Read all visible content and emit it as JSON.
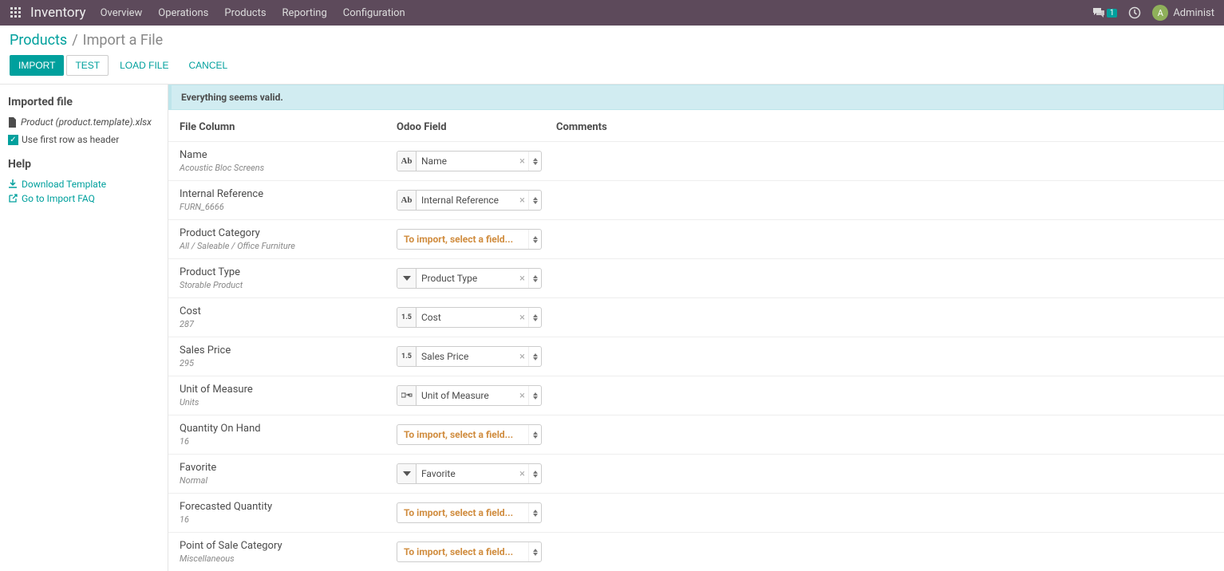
{
  "topbar": {
    "app_name": "Inventory",
    "nav": [
      "Overview",
      "Operations",
      "Products",
      "Reporting",
      "Configuration"
    ],
    "chat_badge": "1",
    "user_initial": "A",
    "user_name": "Administ"
  },
  "breadcrumb": {
    "parent": "Products",
    "current": "Import a File"
  },
  "actions": {
    "import": "IMPORT",
    "test": "TEST",
    "load": "LOAD FILE",
    "cancel": "CANCEL"
  },
  "sidebar": {
    "imported_title": "Imported file",
    "file_name": "Product (product.template).xlsx",
    "first_row_label": "Use first row as header",
    "help_title": "Help",
    "download_template": "Download Template",
    "import_faq": "Go to Import FAQ"
  },
  "alert": "Everything seems valid.",
  "headers": {
    "file_column": "File Column",
    "odoo_field": "Odoo Field",
    "comments": "Comments"
  },
  "placeholder": "To import, select a field...",
  "rows": [
    {
      "name": "Name",
      "sample": "Acoustic Bloc Screens",
      "type": "Ab",
      "value": "Name",
      "mapped": true
    },
    {
      "name": "Internal Reference",
      "sample": "FURN_6666",
      "type": "Ab",
      "value": "Internal Reference",
      "mapped": true
    },
    {
      "name": "Product Category",
      "sample": "All / Saleable / Office Furniture",
      "type": "",
      "value": "",
      "mapped": false
    },
    {
      "name": "Product Type",
      "sample": "Storable Product",
      "type": "▼",
      "value": "Product Type",
      "mapped": true
    },
    {
      "name": "Cost",
      "sample": "287",
      "type": "1.5",
      "value": "Cost",
      "mapped": true
    },
    {
      "name": "Sales Price",
      "sample": "295",
      "type": "1.5",
      "value": "Sales Price",
      "mapped": true
    },
    {
      "name": "Unit of Measure",
      "sample": "Units",
      "type": "uom",
      "value": "Unit of Measure",
      "mapped": true
    },
    {
      "name": "Quantity On Hand",
      "sample": "16",
      "type": "",
      "value": "",
      "mapped": false
    },
    {
      "name": "Favorite",
      "sample": "Normal",
      "type": "▼",
      "value": "Favorite",
      "mapped": true
    },
    {
      "name": "Forecasted Quantity",
      "sample": "16",
      "type": "",
      "value": "",
      "mapped": false
    },
    {
      "name": "Point of Sale Category",
      "sample": "Miscellaneous",
      "type": "",
      "value": "",
      "mapped": false
    }
  ]
}
